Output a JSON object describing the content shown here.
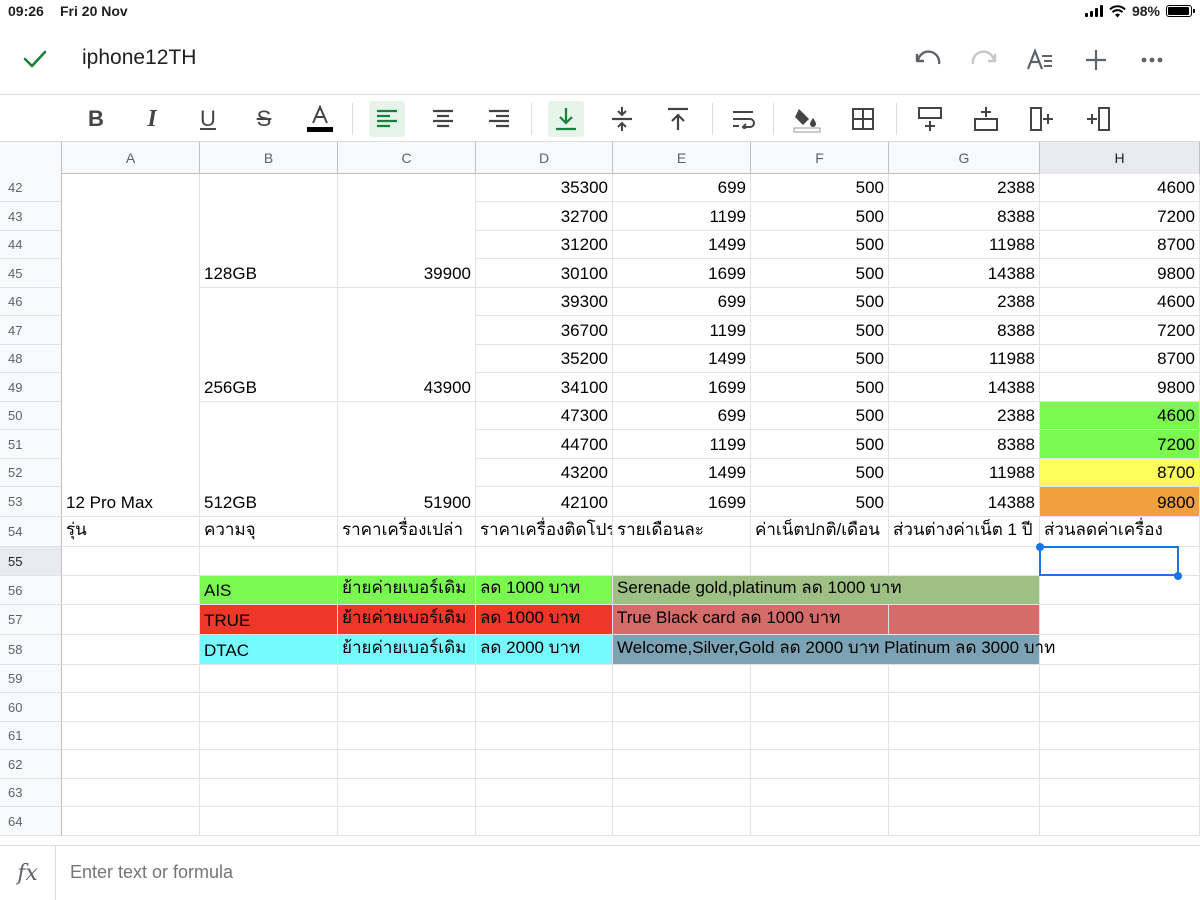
{
  "status_bar": {
    "time": "09:26",
    "date": "Fri 20 Nov",
    "battery": "98%"
  },
  "header": {
    "doc_title": "iphone12TH"
  },
  "toolbar": {
    "icons": [
      "bold-icon",
      "italic-icon",
      "underline-icon",
      "strikethrough-icon",
      "text-color-icon",
      "align-left-icon",
      "align-center-icon",
      "align-right-icon",
      "valign-bottom-icon",
      "valign-middle-icon",
      "valign-top-icon",
      "wrap-icon",
      "fill-color-icon",
      "borders-icon",
      "insert-row-above-icon",
      "insert-row-below-icon",
      "insert-column-left-icon",
      "insert-column-right-icon"
    ]
  },
  "columns": [
    "A",
    "B",
    "C",
    "D",
    "E",
    "F",
    "G",
    "H"
  ],
  "selected_column": "H",
  "selected_row": "55",
  "rows": [
    "42",
    "43",
    "44",
    "45",
    "46",
    "47",
    "48",
    "49",
    "50",
    "51",
    "52",
    "53",
    "54",
    "55",
    "56",
    "57",
    "58",
    "59",
    "60",
    "61",
    "62",
    "63",
    "64"
  ],
  "values": {
    "D": [
      "35300",
      "32700",
      "31200",
      "30100",
      "39300",
      "36700",
      "35200",
      "34100",
      "47300",
      "44700",
      "43200",
      "42100"
    ],
    "E": [
      "699",
      "1199",
      "1499",
      "1699",
      "699",
      "1199",
      "1499",
      "1699",
      "699",
      "1199",
      "1499",
      "1699"
    ],
    "F": [
      "500",
      "500",
      "500",
      "500",
      "500",
      "500",
      "500",
      "500",
      "500",
      "500",
      "500",
      "500"
    ],
    "G": [
      "2388",
      "8388",
      "11988",
      "14388",
      "2388",
      "8388",
      "11988",
      "14388",
      "2388",
      "8388",
      "11988",
      "14388"
    ],
    "H": [
      "4600",
      "7200",
      "8700",
      "9800",
      "4600",
      "7200",
      "8700",
      "9800",
      "4600",
      "7200",
      "8700",
      "9800"
    ]
  },
  "merged": {
    "model": "12 Pro Max",
    "storage": [
      "128GB",
      "256GB",
      "512GB"
    ],
    "price": [
      "39900",
      "43900",
      "51900"
    ]
  },
  "header_row": [
    "รุ่น",
    "ความจุ",
    "ราคาเครื่องเปล่า",
    "ราคาเครื่องติดโปร",
    "รายเดือนละ",
    "ค่าเน็ตปกติ/เดือน",
    "ส่วนต่างค่าเน็ต 1 ปี",
    "ส่วนลดค่าเครื่อง"
  ],
  "promos": [
    {
      "carrier": "AIS",
      "type": "ย้ายค่ายเบอร์เดิม",
      "discount": "ลด 1000  บาท",
      "note": "Serenade gold,platinum ลด 1000 บาท"
    },
    {
      "carrier": "TRUE",
      "type": "ย้ายค่ายเบอร์เดิม",
      "discount": "ลด 1000  บาท",
      "note": "True Black card ลด 1000 บาท"
    },
    {
      "carrier": "DTAC",
      "type": "ย้ายค่ายเบอร์เดิม",
      "discount": "ลด 2000 บาท",
      "note": "Welcome,Silver,Gold ลด 2000 บาท Platinum ลด 3000 บาท"
    }
  ],
  "colors": {
    "green": "#7af950",
    "yellow": "#fefe5d",
    "orange": "#f0a03c",
    "red": "#ee3728",
    "cyan": "#77fafe",
    "sage": "#9fc085",
    "rose": "#d46c69",
    "slate": "#7ba3b4",
    "accent": "#1a73e8",
    "check": "#188038"
  },
  "formula_bar": {
    "placeholder": "Enter text or formula"
  }
}
